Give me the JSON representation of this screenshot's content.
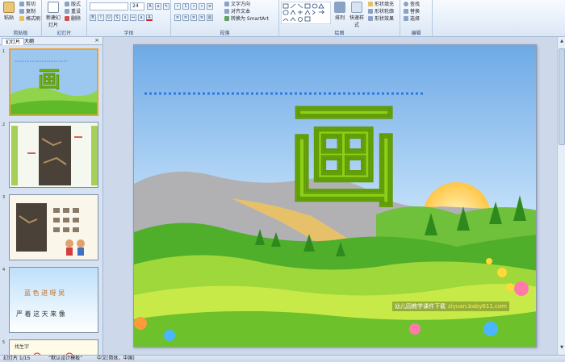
{
  "ribbon": {
    "clipboard": {
      "label": "剪贴板",
      "paste": "粘贴",
      "cut": "剪切",
      "copy": "复制",
      "format_painter": "格式刷"
    },
    "slides": {
      "label": "幻灯片",
      "new_slide": "新建幻灯片",
      "layout": "版式",
      "reset": "重设",
      "delete": "删除"
    },
    "font": {
      "label": "字体",
      "font_name": "",
      "font_size": "24"
    },
    "paragraph": {
      "label": "段落",
      "text_direction": "文字方向",
      "align_text": "对齐文本",
      "smartart": "转换为 SmartArt"
    },
    "drawing": {
      "label": "绘图",
      "arrange": "排列",
      "quick_styles": "快速样式",
      "shape_fill": "形状填充",
      "shape_outline": "形状轮廓",
      "shape_effects": "形状效果"
    },
    "editing": {
      "label": "编辑",
      "find": "查找",
      "replace": "替换",
      "select": "选择"
    }
  },
  "left_pane": {
    "tabs": [
      "幻灯片",
      "大纲"
    ],
    "close": "×",
    "thumbnails": [
      {
        "number": "1"
      },
      {
        "number": "2"
      },
      {
        "number": "3"
      },
      {
        "number": "4",
        "row1": "蓝 色 进 呀 吴",
        "row2": "严 着 这 天 来 像"
      },
      {
        "number": "5",
        "title": "找生字"
      }
    ]
  },
  "slide": {
    "character": "画",
    "watermark_text": "幼儿园教学课件下载",
    "watermark_url": "ziyuan.baby611.com"
  },
  "statusbar": {
    "slide_info": "幻灯片 1/15",
    "theme": "“默认设计模板”",
    "language": "中文(简体，中国)"
  },
  "colors": {
    "accent": "#8ccf16",
    "ribbon": "#dbe7f5",
    "sky": "#9cc8f0"
  }
}
